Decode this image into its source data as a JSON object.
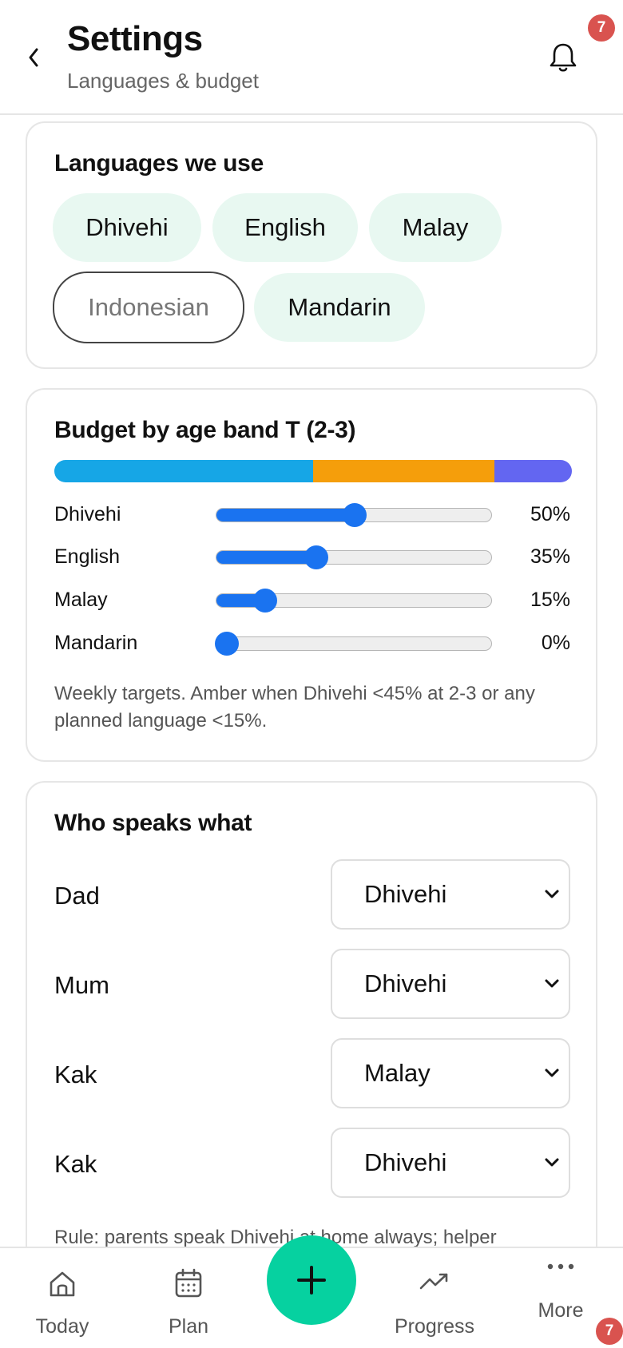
{
  "header": {
    "title": "Settings",
    "subtitle": "Languages & budget",
    "notification_count": "7"
  },
  "languages": {
    "title": "Languages we use",
    "chips": [
      {
        "label": "Dhivehi",
        "selected": true
      },
      {
        "label": "English",
        "selected": true
      },
      {
        "label": "Malay",
        "selected": true
      },
      {
        "label": "Indonesian",
        "selected": false
      },
      {
        "label": "Mandarin",
        "selected": true
      }
    ]
  },
  "budget": {
    "title": "Budget by age band T (2-3)",
    "bar_colors": [
      "#16a6e6",
      "#f59e0b",
      "#6366f1"
    ],
    "rows": [
      {
        "label": "Dhivehi",
        "value": 50,
        "display": "50%"
      },
      {
        "label": "English",
        "value": 35,
        "display": "35%"
      },
      {
        "label": "Malay",
        "value": 15,
        "display": "15%"
      },
      {
        "label": "Mandarin",
        "value": 0,
        "display": "0%"
      }
    ],
    "note": "Weekly targets. Amber when Dhivehi <45% at 2-3 or any planned language <15%."
  },
  "speakers": {
    "title": "Who speaks what",
    "rows": [
      {
        "person": "Dad",
        "language": "Dhivehi"
      },
      {
        "person": "Mum",
        "language": "Dhivehi"
      },
      {
        "person": "Kak",
        "language": "Malay"
      },
      {
        "person": "Kak",
        "language": "Dhivehi"
      }
    ],
    "rule": "Rule: parents speak Dhivehi at home always; helper"
  },
  "nav": {
    "today": "Today",
    "plan": "Plan",
    "progress": "Progress",
    "more": "More",
    "more_badge": "7"
  },
  "colors": {
    "accent": "#06d1a0",
    "slider": "#1a73f0",
    "chip_bg": "#e8f8f1",
    "badge": "#d9534f"
  }
}
